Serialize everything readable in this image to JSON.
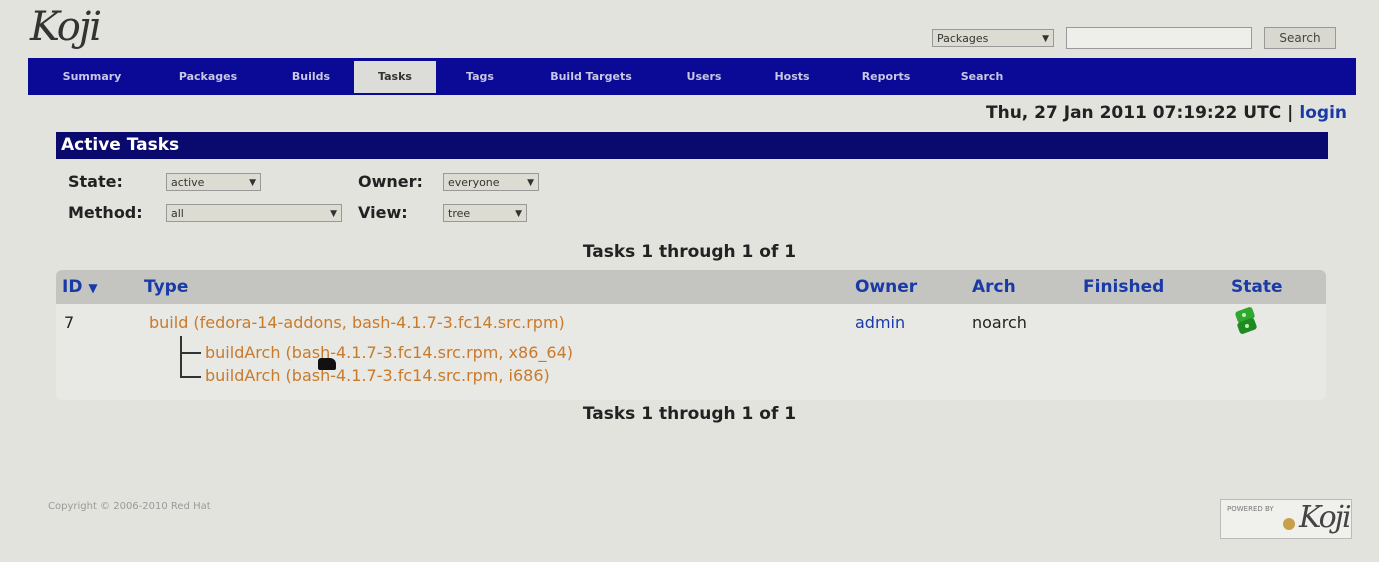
{
  "logo": "Koji",
  "search": {
    "type_value": "Packages",
    "button_label": "Search"
  },
  "nav": {
    "tabs": [
      {
        "label": "Summary"
      },
      {
        "label": "Packages"
      },
      {
        "label": "Builds"
      },
      {
        "label": "Tasks"
      },
      {
        "label": "Tags"
      },
      {
        "label": "Build Targets"
      },
      {
        "label": "Users"
      },
      {
        "label": "Hosts"
      },
      {
        "label": "Reports"
      },
      {
        "label": "Search"
      }
    ],
    "active": "Tasks"
  },
  "header": {
    "datetime": "Thu, 27 Jan 2011 07:19:22 UTC",
    "separator": "|",
    "login_label": "login"
  },
  "section_title": "Active Tasks",
  "filters": {
    "state_label": "State:",
    "state_value": "active",
    "owner_label": "Owner:",
    "owner_value": "everyone",
    "method_label": "Method:",
    "method_value": "all",
    "view_label": "View:",
    "view_value": "tree"
  },
  "pager_text": "Tasks 1 through 1 of 1",
  "table": {
    "columns": {
      "id": "ID",
      "sort_indicator": "▼",
      "type": "Type",
      "owner": "Owner",
      "arch": "Arch",
      "finished": "Finished",
      "state": "State"
    },
    "rows": [
      {
        "id": "7",
        "type": "build (fedora-14-addons, bash-4.1.7-3.fc14.src.rpm)",
        "owner": "admin",
        "arch": "noarch",
        "finished": "",
        "state_icon": "running-gears-icon",
        "children": [
          {
            "type": "buildArch (bash-4.1.7-3.fc14.src.rpm, x86_64)"
          },
          {
            "type": "buildArch (bash-4.1.7-3.fc14.src.rpm, i686)"
          }
        ]
      }
    ]
  },
  "footer": {
    "copyright": "Copyright © 2006-2010 Red Hat",
    "badge_small": "POWERED BY",
    "badge_mark": "Koji"
  },
  "colors": {
    "nav_bg": "#0a0a96",
    "section_bg": "#0a0a6e",
    "link_blue": "#1a3aa8",
    "link_build": "#c97a2a",
    "state_icon_green": "#2ea82e"
  }
}
